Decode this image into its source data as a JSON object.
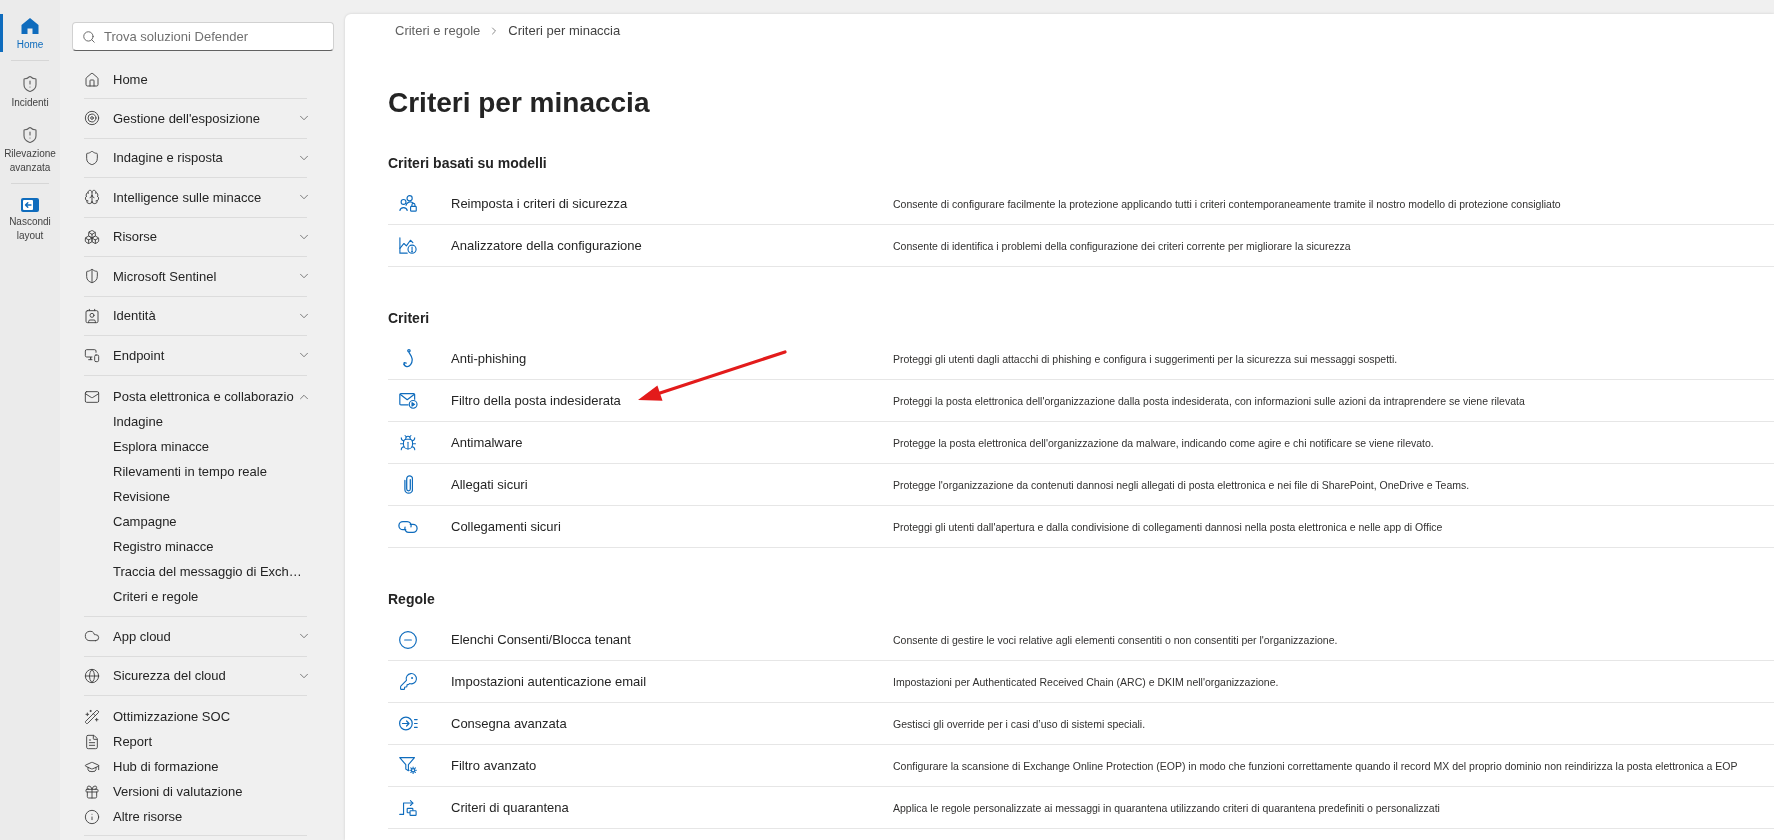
{
  "rail": {
    "groups": [
      {
        "items": [
          {
            "label": "Home",
            "selected": true
          }
        ]
      },
      {
        "items": [
          {
            "label": "Incidenti",
            "selected": false
          },
          {
            "label": "Rilevazione avanzata",
            "selected": false
          }
        ]
      },
      {
        "items": [
          {
            "label": "Nascondi layout",
            "selected": false
          }
        ]
      }
    ]
  },
  "sidebar": {
    "search": {
      "placeholder": "Trova soluzioni Defender"
    },
    "nav": [
      {
        "kind": "links",
        "items": [
          {
            "label": "Home"
          }
        ]
      },
      {
        "kind": "section",
        "label": "Gestione dell'esposizione",
        "expanded": false
      },
      {
        "kind": "section",
        "label": "Indagine e risposta",
        "expanded": false
      },
      {
        "kind": "section",
        "label": "Intelligence sulle minacce",
        "expanded": false
      },
      {
        "kind": "section",
        "label": "Risorse",
        "expanded": false
      },
      {
        "kind": "section",
        "label": "Microsoft Sentinel",
        "expanded": false
      },
      {
        "kind": "section",
        "label": "Identità",
        "expanded": false
      },
      {
        "kind": "section",
        "label": "Endpoint",
        "expanded": false
      },
      {
        "kind": "section",
        "label": "Posta elettronica e collaborazio",
        "expanded": true,
        "children": [
          {
            "label": "Indagine"
          },
          {
            "label": "Esplora minacce"
          },
          {
            "label": "Rilevamenti in tempo reale"
          },
          {
            "label": "Revisione"
          },
          {
            "label": "Campagne"
          },
          {
            "label": "Registro minacce"
          },
          {
            "label": "Traccia del messaggio di Exch…"
          },
          {
            "label": "Criteri e regole"
          }
        ]
      },
      {
        "kind": "section",
        "label": "App cloud",
        "expanded": false
      },
      {
        "kind": "section",
        "label": "Sicurezza del cloud",
        "expanded": false
      },
      {
        "kind": "links",
        "items": [
          {
            "label": "Ottimizzazione SOC"
          },
          {
            "label": "Report"
          },
          {
            "label": "Hub di formazione"
          },
          {
            "label": "Versioni di valutazione"
          },
          {
            "label": "Altre risorse"
          }
        ]
      }
    ]
  },
  "main": {
    "breadcrumb": [
      {
        "label": "Criteri e regole"
      },
      {
        "label": "Criteri per minaccia"
      }
    ],
    "title": "Criteri per minaccia",
    "sections": [
      {
        "heading": "Criteri basati su modelli",
        "rows": [
          {
            "title": "Reimposta i criteri di sicurezza",
            "description": "Consente di configurare facilmente la protezione applicando tutti i criteri contemporaneamente tramite il nostro modello di protezione consigliato",
            "marked_by_arrow": false
          },
          {
            "title": "Analizzatore della configurazione",
            "description": "Consente di identifica i problemi della configurazione dei criteri corrente per migliorare la sicurezza",
            "marked_by_arrow": false
          }
        ]
      },
      {
        "heading": "Criteri",
        "rows": [
          {
            "title": "Anti-phishing",
            "description": "Proteggi gli utenti dagli attacchi di phishing e configura i suggerimenti per la sicurezza sui messaggi sospetti.",
            "marked_by_arrow": false
          },
          {
            "title": "Filtro della posta indesiderata",
            "description": "Proteggi la posta elettronica dell'organizzazione dalla posta indesiderata, con informazioni sulle azioni da intraprendere se viene rilevata",
            "marked_by_arrow": true
          },
          {
            "title": "Antimalware",
            "description": "Protegge la posta elettronica dell'organizzazione da malware, indicando come agire e chi notificare se viene rilevato.",
            "marked_by_arrow": false
          },
          {
            "title": "Allegati sicuri",
            "description": "Protegge l'organizzazione da contenuti dannosi negli allegati di posta elettronica e nei file di SharePoint, OneDrive e Teams.",
            "marked_by_arrow": false
          },
          {
            "title": "Collegamenti sicuri",
            "description": "Proteggi gli utenti dall'apertura e dalla condivisione di collegamenti dannosi nella posta elettronica e nelle app di Office",
            "marked_by_arrow": false
          }
        ]
      },
      {
        "heading": "Regole",
        "rows": [
          {
            "title": "Elenchi Consenti/Blocca tenant",
            "description": "Consente di gestire le voci relative agli elementi consentiti o non consentiti per l'organizzazione.",
            "marked_by_arrow": false
          },
          {
            "title": "Impostazioni autenticazione email",
            "description": "Impostazioni per Authenticated Received Chain (ARC) e DKIM nell'organizzazione.",
            "marked_by_arrow": false
          },
          {
            "title": "Consegna avanzata",
            "description": "Gestisci gli override per i casi d’uso di sistemi speciali.",
            "marked_by_arrow": false
          },
          {
            "title": "Filtro avanzato",
            "description": "Configurare la scansione di Exchange Online Protection (EOP) in modo che funzioni correttamente quando il record MX del proprio dominio non reindirizza la posta elettronica a EOP",
            "marked_by_arrow": false
          },
          {
            "title": "Criteri di quarantena",
            "description": "Applica le regole personalizzate ai messaggi in quarantena utilizzando criteri di quarantena predefiniti o personalizzati",
            "marked_by_arrow": false
          }
        ]
      }
    ]
  }
}
